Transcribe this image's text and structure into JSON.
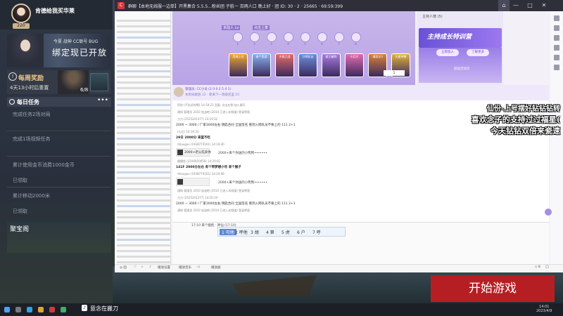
{
  "streamer": {
    "name": "肯德给我买华莱",
    "level": "220"
  },
  "promo": {
    "line1": "今夏 战神 CC联号 BUG",
    "line2": "绑定现已开放"
  },
  "reward": {
    "title": "每周奖励",
    "sub": "4天13小时后重置",
    "count": "6/8"
  },
  "tasks": {
    "header": "每日任务",
    "more": "•••",
    "items": [
      "完成任务2场对局",
      "完成1场视频任务",
      "累计使用金币消费1000金币",
      "已领取",
      "累计移动2000米",
      "已领取"
    ]
  },
  "treasure": {
    "title": "聚宝阁"
  },
  "app": {
    "title": "群聊【本地无线服一边单】开黑集合 5.5.5...粉丝团 子航一 百两人口 晚上好 · 团 ID: 30 · 2 · 25665 · 69:59:399",
    "win_controls": [
      "—",
      "□",
      "✕"
    ]
  },
  "stage": {
    "labels": [
      "本陆人 Lv",
      "点击上麦"
    ],
    "seat_numbers": [
      "1",
      "2",
      "3",
      "4",
      "5",
      "6",
      "7",
      "8"
    ],
    "cards": [
      "西域上位",
      "奋个西游",
      "天极之战",
      "口哨花丛",
      "侯王破阵",
      "小兵大",
      "漫游记3",
      "天星神兽"
    ],
    "stepper": "1"
  },
  "right_panel": {
    "title": "主持人榜 (5)",
    "banner": "主持成长特训营",
    "btn1": "立即加入",
    "btn2": "了解更多",
    "caption": "前往活动页"
  },
  "chat_header": {
    "name": "管理员: CC小号 (2 0 0 2 5 4 1)",
    "sub": "本周贡献值 12 · 距离下一等级还差 25"
  },
  "chat": [
    {
      "meta": "阿良 (不告诉你啊) 14:18:22 回复: 点击右侧 加入聊天",
      "text": "",
      "type": "msg"
    },
    {
      "meta": "通知  管理员 2010 加油吧  (2010 已进入本频道) 登录界面",
      "text": "",
      "type": "meta"
    },
    {
      "meta": "刀刀 (2525241377) 14:19:32",
      "text": "2000 ~ 3000 / 厂家3000左右  钥匙合同 全国签名  看到入网队员不要上的  111 2+1",
      "type": "msg"
    },
    {
      "meta": "(元旦) 14:19:33",
      "text": "29日  2000分  来蓝不吃",
      "type": "bold"
    },
    {
      "meta": "Ahaugov (1938770161) 14:19:40",
      "text": "2000+老公先奔你",
      "gift": "2000+来个你送的小熊熊•••••••",
      "type": "gift"
    },
    {
      "meta": "傻傻鱼 (2100650656) 14:20:02",
      "text": "141F  2000分左右  有个带梦想小号  来个猴子",
      "type": "bold"
    },
    {
      "meta": "Ahaugov (1938770161) 14:20:06",
      "text": "",
      "gift": "2000+来个你送的小熊熊•••••••",
      "type": "gift"
    },
    {
      "meta": "通知  管理员 2010 加油吧  (2010 已进入本频道) 登录界面",
      "text": "",
      "type": "meta"
    },
    {
      "meta": "刀刀 (2525241377) 14:20:19",
      "text": "2000 ~ 3000 / 厂家3000左右  钥匙合同 全国签名  看到入网队员不要上的  111 2+1",
      "type": "msg"
    },
    {
      "meta": "通知  管理员 2010 加油吧  (2010 已进入本频道) 登录界面",
      "text": "",
      "type": "meta"
    }
  ],
  "composer": {
    "text": "17:10  来个瘦脸 · 神仙  (17:10)",
    "ime": [
      "1 可他",
      "2 呼他",
      "3 胡",
      "4 第",
      "5 虎",
      "6 户",
      "7 呼"
    ],
    "ime_selected": 0
  },
  "statusbar": [
    "◎ 团",
    "♡",
    "☆",
    "♪",
    "播放设置",
    "播放音乐",
    "◁",
    "播放器",
    "◇ 8",
    "◯"
  ],
  "overlay": [
    "仙份-上号摆好钻钻钻转",
    "喜欢念子的支持过过福星(",
    "今天钻钻双倍来瓷速"
  ],
  "start_button": "开始游戏",
  "taskbar": {
    "app_name": "意念在搬刀",
    "clock_time": "14:01",
    "clock_date": "2023/4/9"
  },
  "colors": {
    "accent": "#8f74d6",
    "start_button": "#b51f24",
    "reward_title": "#f0c58a"
  }
}
